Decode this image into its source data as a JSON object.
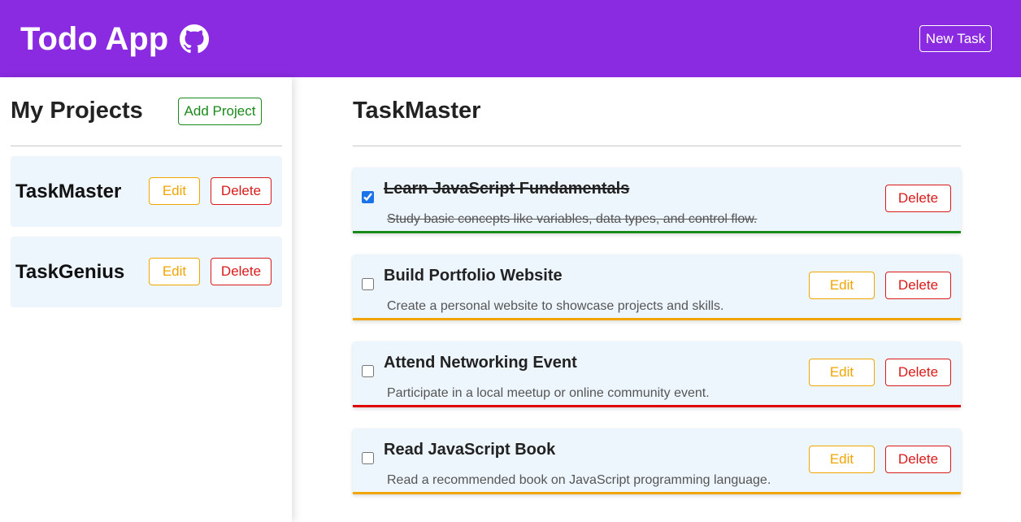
{
  "header": {
    "title": "Todo App",
    "brand_color": "#8a2be2",
    "icon": "github-icon",
    "new_task_label": "New Task"
  },
  "sidebar": {
    "title": "My Projects",
    "add_project_label": "Add Project",
    "projects": [
      {
        "name": "TaskMaster",
        "edit_label": "Edit",
        "delete_label": "Delete"
      },
      {
        "name": "TaskGenius",
        "edit_label": "Edit",
        "delete_label": "Delete"
      }
    ]
  },
  "main": {
    "project_title": "TaskMaster",
    "tasks": [
      {
        "title": "Learn JavaScript Fundamentals",
        "description": "Study basic concepts like variables, data types, and control flow.",
        "completed": true,
        "priority_color": "#1a8a1a",
        "delete_label": "Delete"
      },
      {
        "title": "Build Portfolio Website",
        "description": "Create a personal website to showcase projects and skills.",
        "completed": false,
        "priority_color": "#f0a500",
        "edit_label": "Edit",
        "delete_label": "Delete"
      },
      {
        "title": "Attend Networking Event",
        "description": "Participate in a local meetup or online community event.",
        "completed": false,
        "priority_color": "#e00000",
        "edit_label": "Edit",
        "delete_label": "Delete"
      },
      {
        "title": "Read JavaScript Book",
        "description": "Read a recommended book on JavaScript programming language.",
        "completed": false,
        "priority_color": "#f0a500",
        "edit_label": "Edit",
        "delete_label": "Delete"
      }
    ]
  }
}
